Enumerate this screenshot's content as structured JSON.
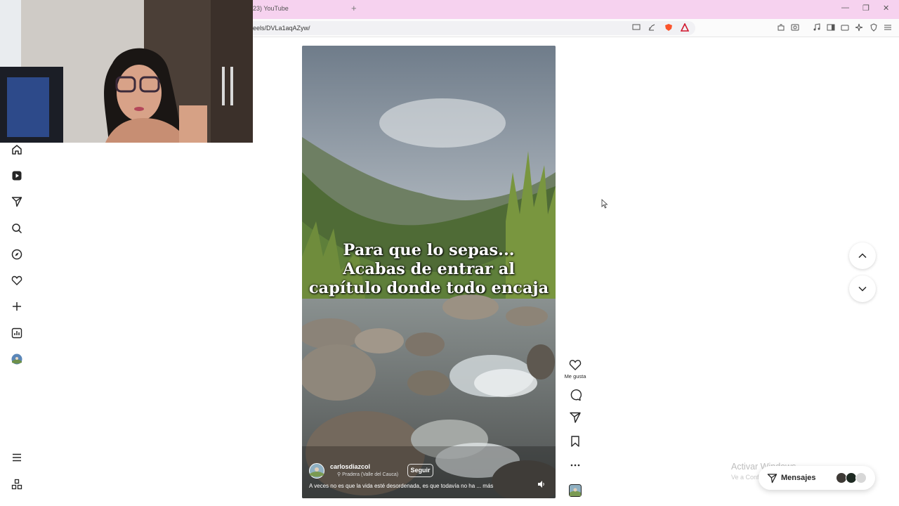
{
  "browser": {
    "tab_title": "23) YouTube",
    "url": "eels/DVLa1aqAZyw/"
  },
  "sidebar": {
    "items": [
      "home-icon",
      "reels-icon",
      "send-icon",
      "search-icon",
      "explore-icon",
      "heart-icon",
      "create-icon",
      "insights-icon",
      "profile-avatar"
    ],
    "bottom": [
      "menu-icon",
      "more-apps-icon"
    ]
  },
  "reel": {
    "caption_lines": [
      "Para que lo sepas...",
      "Acabas de entrar al",
      "capítulo donde todo encaja"
    ],
    "username": "carlosdiazcol",
    "location": "Pradera (Valle del Cauca)",
    "follow_label": "Seguir",
    "description": "A veces no es que la vida esté desordenada, es que todavía no ha ... más"
  },
  "actions": {
    "like_label": "Me gusta"
  },
  "watermark": {
    "title": "Activar Windows",
    "subtitle": "Ve a Configuración para activar Windows."
  },
  "messages": {
    "label": "Mensajes"
  },
  "colors": {
    "tab_bar": "#f6d2ef",
    "accent": "#262626"
  }
}
